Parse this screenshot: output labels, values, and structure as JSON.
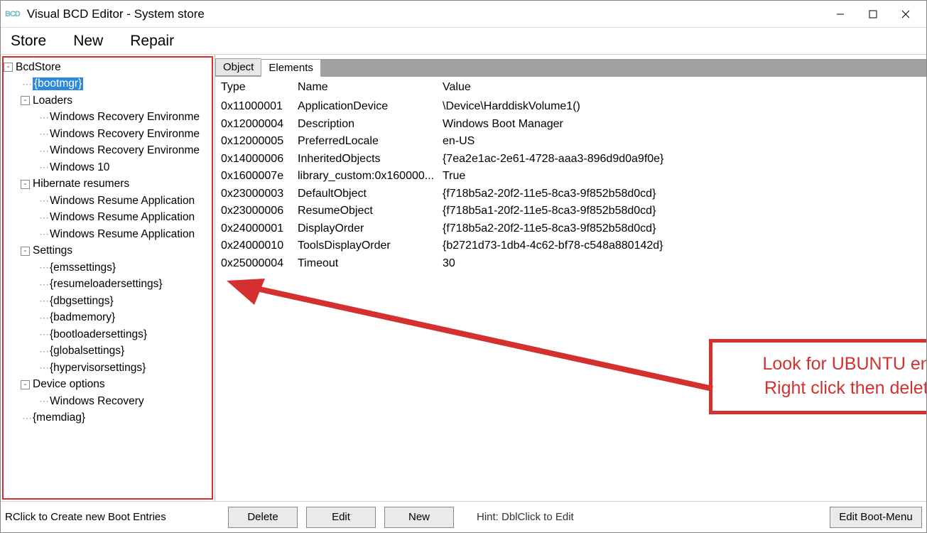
{
  "window": {
    "title": "Visual BCD Editor - System store"
  },
  "menu": {
    "items": [
      "Store",
      "New",
      "Repair"
    ]
  },
  "tree": {
    "nodes": [
      {
        "depth": 0,
        "toggle": "-",
        "label": "BcdStore"
      },
      {
        "depth": 1,
        "toggle": "",
        "label": "{bootmgr}",
        "selected": true
      },
      {
        "depth": 1,
        "toggle": "-",
        "label": "Loaders"
      },
      {
        "depth": 2,
        "toggle": "",
        "label": "Windows Recovery Environme"
      },
      {
        "depth": 2,
        "toggle": "",
        "label": "Windows Recovery Environme"
      },
      {
        "depth": 2,
        "toggle": "",
        "label": "Windows Recovery Environme"
      },
      {
        "depth": 2,
        "toggle": "",
        "label": "Windows 10"
      },
      {
        "depth": 1,
        "toggle": "-",
        "label": "Hibernate resumers"
      },
      {
        "depth": 2,
        "toggle": "",
        "label": "Windows Resume Application"
      },
      {
        "depth": 2,
        "toggle": "",
        "label": "Windows Resume Application"
      },
      {
        "depth": 2,
        "toggle": "",
        "label": "Windows Resume Application"
      },
      {
        "depth": 1,
        "toggle": "-",
        "label": "Settings"
      },
      {
        "depth": 2,
        "toggle": "",
        "label": "{emssettings}"
      },
      {
        "depth": 2,
        "toggle": "",
        "label": "{resumeloadersettings}"
      },
      {
        "depth": 2,
        "toggle": "",
        "label": "{dbgsettings}"
      },
      {
        "depth": 2,
        "toggle": "",
        "label": "{badmemory}"
      },
      {
        "depth": 2,
        "toggle": "",
        "label": "{bootloadersettings}"
      },
      {
        "depth": 2,
        "toggle": "",
        "label": "{globalsettings}"
      },
      {
        "depth": 2,
        "toggle": "",
        "label": "{hypervisorsettings}"
      },
      {
        "depth": 1,
        "toggle": "-",
        "label": "Device options"
      },
      {
        "depth": 2,
        "toggle": "",
        "label": "Windows Recovery"
      },
      {
        "depth": 1,
        "toggle": "",
        "label": "{memdiag}"
      }
    ]
  },
  "tabs": {
    "object": "Object",
    "elements": "Elements"
  },
  "grid": {
    "headers": {
      "type": "Type",
      "name": "Name",
      "value": "Value"
    },
    "rows": [
      {
        "type": "0x11000001",
        "name": "ApplicationDevice",
        "value": "\\Device\\HarddiskVolume1()"
      },
      {
        "type": "0x12000004",
        "name": "Description",
        "value": "Windows Boot Manager"
      },
      {
        "type": "0x12000005",
        "name": "PreferredLocale",
        "value": "en-US"
      },
      {
        "type": "0x14000006",
        "name": "InheritedObjects",
        "value": "{7ea2e1ac-2e61-4728-aaa3-896d9d0a9f0e}"
      },
      {
        "type": "0x1600007e",
        "name": "library_custom:0x160000...",
        "value": "True"
      },
      {
        "type": "0x23000003",
        "name": "DefaultObject",
        "value": "{f718b5a2-20f2-11e5-8ca3-9f852b58d0cd}"
      },
      {
        "type": "0x23000006",
        "name": "ResumeObject",
        "value": "{f718b5a1-20f2-11e5-8ca3-9f852b58d0cd}"
      },
      {
        "type": "0x24000001",
        "name": "DisplayOrder",
        "value": "{f718b5a2-20f2-11e5-8ca3-9f852b58d0cd}"
      },
      {
        "type": "0x24000010",
        "name": "ToolsDisplayOrder",
        "value": "{b2721d73-1db4-4c62-bf78-c548a880142d}"
      },
      {
        "type": "0x25000004",
        "name": "Timeout",
        "value": "30"
      }
    ]
  },
  "footer": {
    "delete": "Delete",
    "edit": "Edit",
    "new": "New",
    "hint": "Hint: DblClick to Edit",
    "editBoot": "Edit Boot-Menu",
    "leftHint": "RClick to Create new Boot Entries"
  },
  "callout": {
    "line1": "Look for UBUNTU entry.",
    "line2": "Right click then delete it"
  }
}
